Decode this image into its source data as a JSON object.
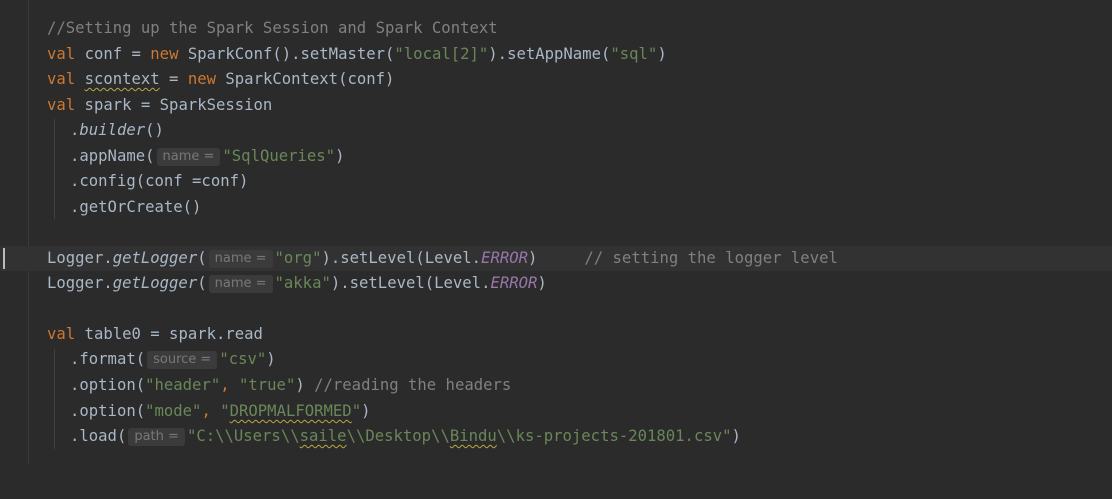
{
  "editor": {
    "lines": [
      {
        "comment": "//Setting up the Spark Session and Spark Context"
      },
      {
        "kw": "val",
        "name": "conf",
        "eq": " = ",
        "kw2": "new",
        "call": " SparkConf().setMaster(",
        "s1": "\"local[2]\"",
        "mid": ").setAppName(",
        "s2": "\"sql\"",
        "end": ")"
      },
      {
        "kw": "val",
        "name": "scontext",
        "eq": " = ",
        "kw2": "new",
        "call": " SparkContext(conf)"
      },
      {
        "kw": "val",
        "text": " spark = SparkSession"
      },
      {
        "dot": ".",
        "it": "builder",
        "end": "()"
      },
      {
        "text": ".appName(",
        "hint": "name =",
        "str": "\"SqlQueries\"",
        "end": ")"
      },
      {
        "text": ".config(conf =conf)"
      },
      {
        "text": ".getOrCreate()"
      },
      {},
      {
        "pre": "Logger.",
        "it": "getLogger",
        "open": "(",
        "hint": "name =",
        "str": "\"org\"",
        "mid": ").setLevel(Level.",
        "const": "ERROR",
        "end": ")",
        "comment": "// setting the logger level"
      },
      {
        "pre": "Logger.",
        "it": "getLogger",
        "open": "(",
        "hint": "name =",
        "str": "\"akka\"",
        "mid": ").setLevel(Level.",
        "const": "ERROR",
        "end": ")"
      },
      {},
      {
        "kw": "val",
        "text": " table0 = spark.read"
      },
      {
        "text": ".format(",
        "hint": "source =",
        "str": "\"csv\"",
        "end": ")"
      },
      {
        "text": ".option(",
        "s1": "\"header\"",
        "kw": ", ",
        "s2": "\"true\"",
        "end": ") ",
        "comment": "//reading the headers"
      },
      {
        "text": ".option(",
        "s1": "\"mode\"",
        "kw": ", ",
        "s2q": "\"",
        "s2w": "DROPMALFORMED",
        "s2e": "\"",
        "end": ")"
      },
      {
        "text": ".load(",
        "hint": "path =",
        "p1": "\"C:\\\\Users\\\\",
        "p2": "saile",
        "p3": "\\\\Desktop\\\\",
        "p4": "Bindu",
        "p5": "\\\\ks-projects-201801.csv\"",
        "end": ")"
      }
    ]
  }
}
